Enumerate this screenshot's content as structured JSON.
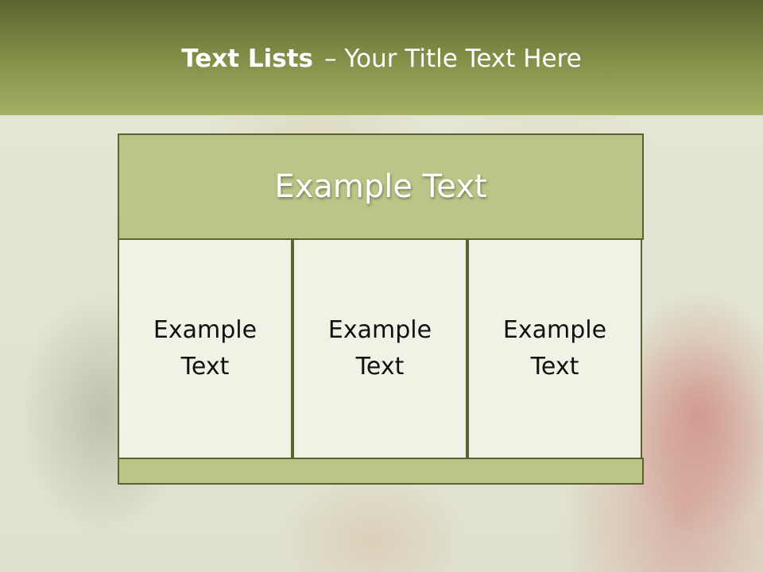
{
  "slide": {
    "title_bold": "Text Lists",
    "title_rest": "– Your Title Text Here"
  },
  "panel": {
    "header": "Example Text",
    "columns": [
      {
        "label": "Example Text"
      },
      {
        "label": "Example Text"
      },
      {
        "label": "Example Text"
      }
    ]
  },
  "colors": {
    "header_dark": "#5d6431",
    "header_light": "#a5b066",
    "accent_fill": "#bcc488",
    "cell_fill": "#f0f2e6",
    "border": "#5a6234"
  }
}
